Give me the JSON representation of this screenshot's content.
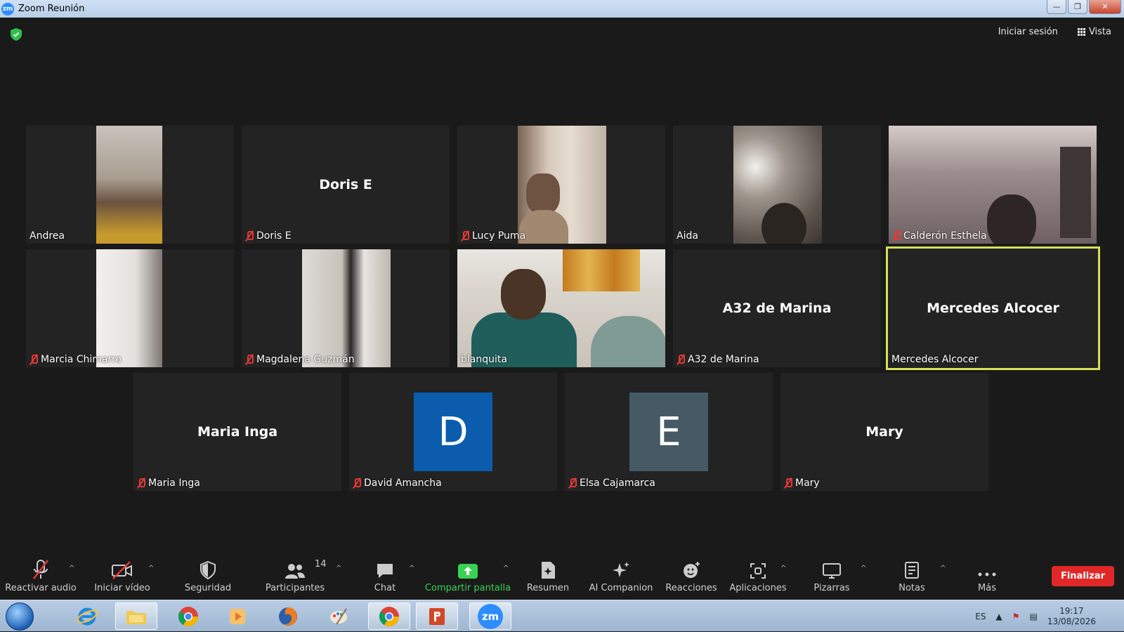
{
  "window": {
    "title": "Zoom Reunión",
    "app_badge": "zm"
  },
  "topbar": {
    "sign_in": "Iniciar sesión",
    "view": "Vista"
  },
  "participants": [
    {
      "label": "Andrea",
      "display": "",
      "muted": false,
      "video": true
    },
    {
      "label": "Doris E",
      "display": "Doris E",
      "muted": true,
      "video": false
    },
    {
      "label": "Lucy Puma",
      "display": "",
      "muted": true,
      "video": true
    },
    {
      "label": "Aida",
      "display": "",
      "muted": false,
      "video": true
    },
    {
      "label": "Calderón Esthela",
      "display": "",
      "muted": true,
      "video": true
    },
    {
      "label": "Marcia Chimarro",
      "display": "",
      "muted": true,
      "video": true
    },
    {
      "label": "Magdalena Guzmán",
      "display": "",
      "muted": true,
      "video": true
    },
    {
      "label": "blanquita",
      "display": "",
      "muted": false,
      "video": true
    },
    {
      "label": "A32 de Marina",
      "display": "A32 de Marina",
      "muted": true,
      "video": false
    },
    {
      "label": "Mercedes  Alcocer",
      "display": "Mercedes  Alcocer",
      "muted": false,
      "video": false,
      "active_speaker": true
    },
    {
      "label": "Maria Inga",
      "display": "Maria Inga",
      "muted": true,
      "video": false
    },
    {
      "label": "David Amancha",
      "avatar_letter": "D",
      "avatar_color": "#0b5cad",
      "muted": true
    },
    {
      "label": "Elsa Cajamarca",
      "avatar_letter": "E",
      "avatar_color": "#455a64",
      "muted": true
    },
    {
      "label": "Mary",
      "display": "Mary",
      "muted": true,
      "video": false
    }
  ],
  "toolbar": {
    "unmute": "Reactivar audio",
    "start_video": "Iniciar vídeo",
    "security": "Seguridad",
    "participants": "Participantes",
    "participant_count": "14",
    "chat": "Chat",
    "share_screen": "Compartir pantalla",
    "summary": "Resumen",
    "ai_companion": "AI Companion",
    "reactions": "Reacciones",
    "apps": "Aplicaciones",
    "whiteboards": "Pizarras",
    "notes": "Notas",
    "more": "Más",
    "end": "Finalizar"
  },
  "taskbar": {
    "language": "ES",
    "time": "19:17",
    "date": "13/08/2026",
    "zoom_badge": "zm"
  },
  "colors": {
    "active_border": "#d4e157",
    "share_green": "#39d353",
    "end_red": "#e02828"
  }
}
